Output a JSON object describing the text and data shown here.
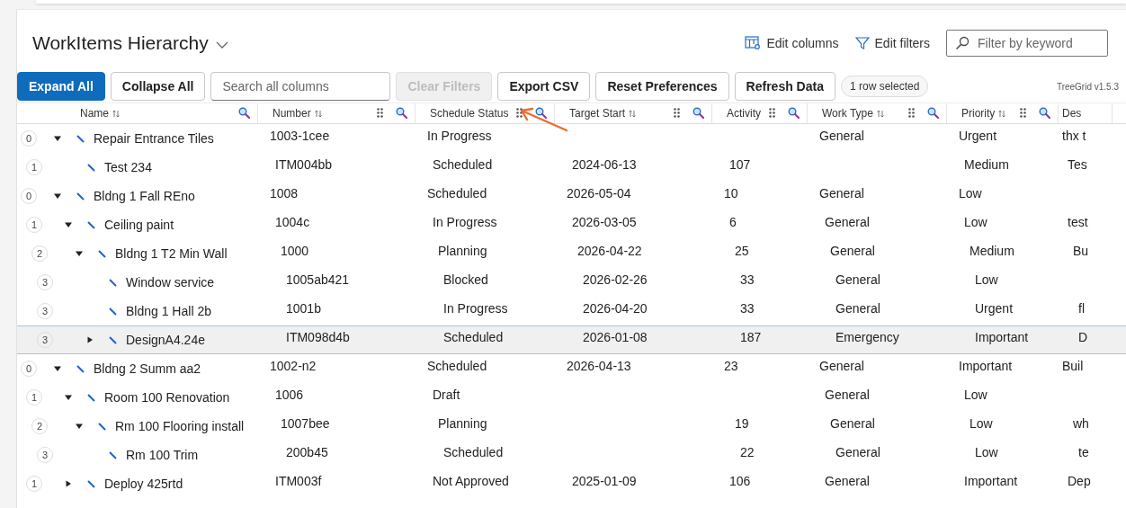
{
  "header": {
    "title": "WorkItems Hierarchy",
    "actions": [
      {
        "kind": "columns",
        "label": "Edit columns"
      },
      {
        "kind": "filters",
        "label": "Edit filters"
      }
    ],
    "keyword_filter": {
      "placeholder": "Filter by keyword"
    }
  },
  "toolbar": {
    "buttons": [
      {
        "label": "Expand All",
        "kind": "primary",
        "disabled": false
      },
      {
        "label": "Collapse All",
        "kind": "default",
        "disabled": false
      },
      {
        "kind": "search",
        "placeholder": "Search all columns"
      },
      {
        "label": "Clear Filters",
        "kind": "default",
        "disabled": true
      },
      {
        "label": "Export CSV",
        "kind": "default",
        "disabled": false
      },
      {
        "label": "Reset Preferences",
        "kind": "default",
        "disabled": false
      },
      {
        "label": "Refresh Data",
        "kind": "default",
        "disabled": false
      }
    ],
    "selection_count": "1 row selected",
    "version": "TreeGrid v1.5.3"
  },
  "table": {
    "columns": [
      {
        "label": "Name",
        "sortable": true,
        "movable": false,
        "filterable": true
      },
      {
        "label": "Number",
        "sortable": true,
        "movable": true,
        "filterable": true
      },
      {
        "label": "Schedule Status",
        "sortable": false,
        "movable": true,
        "filterable": true
      },
      {
        "label": "Target Start",
        "sortable": true,
        "movable": true,
        "filterable": true
      },
      {
        "label": "Activity",
        "sortable": false,
        "movable": true,
        "filterable": true
      },
      {
        "label": "Work Type",
        "sortable": true,
        "movable": true,
        "filterable": true
      },
      {
        "label": "Priority",
        "sortable": true,
        "movable": true,
        "filterable": true
      },
      {
        "label": "Des",
        "sortable": false,
        "movable": false,
        "filterable": false
      }
    ],
    "rows": [
      {
        "level": "0",
        "expanded": true,
        "selected": false,
        "cells": [
          "Repair Entrance Tiles",
          "1003-1cee",
          "In Progress",
          "",
          "",
          "General",
          "Urgent",
          "thx t"
        ],
        "children": [
          {
            "level": "1",
            "selected": false,
            "cells": [
              "Test 234",
              "ITM004bb",
              "Scheduled",
              "2024-06-13",
              "107",
              "",
              "Medium",
              "Tes"
            ]
          }
        ]
      },
      {
        "level": "0",
        "expanded": true,
        "selected": false,
        "cells": [
          "Bldng 1 Fall REno",
          "1008",
          "Scheduled",
          "2026-05-04",
          "10",
          "General",
          "Low",
          ""
        ],
        "children": [
          {
            "level": "1",
            "expanded": true,
            "selected": false,
            "cells": [
              "Ceiling paint",
              "1004c",
              "In Progress",
              "2026-03-05",
              "6",
              "General",
              "Low",
              "test"
            ],
            "children": [
              {
                "level": "2",
                "expanded": true,
                "selected": false,
                "cells": [
                  "Bldng 1 T2 Min Wall",
                  "1000",
                  "Planning",
                  "2026-04-22",
                  "25",
                  "General",
                  "Medium",
                  "Bu"
                ],
                "children": [
                  {
                    "level": "3",
                    "selected": false,
                    "cells": [
                      "Window service",
                      "1005ab421",
                      "Blocked",
                      "2026-02-26",
                      "33",
                      "General",
                      "Low",
                      ""
                    ]
                  },
                  {
                    "level": "3",
                    "selected": false,
                    "cells": [
                      "Bldng 1 Hall 2b",
                      "1001b",
                      "In Progress",
                      "2026-04-20",
                      "33",
                      "General",
                      "Urgent",
                      "fl"
                    ]
                  },
                  {
                    "level": "3",
                    "expanded": false,
                    "selected": true,
                    "cells": [
                      "DesignA4.24e",
                      "ITM098d4b",
                      "Scheduled",
                      "2026-01-08",
                      "187",
                      "Emergency",
                      "Important",
                      "D"
                    ]
                  }
                ]
              }
            ]
          }
        ]
      },
      {
        "level": "0",
        "expanded": true,
        "selected": false,
        "cells": [
          "Bldng 2 Summ aa2",
          "1002-n2",
          "Scheduled",
          "2026-04-13",
          "23",
          "General",
          "Important",
          "Buil"
        ],
        "children": [
          {
            "level": "1",
            "expanded": true,
            "selected": false,
            "cells": [
              "Room 100 Renovation",
              "1006",
              "Draft",
              "",
              "",
              "General",
              "Low",
              ""
            ],
            "children": [
              {
                "level": "2",
                "expanded": true,
                "selected": false,
                "cells": [
                  "Rm 100 Flooring install",
                  "1007bee",
                  "Planning",
                  "",
                  "19",
                  "General",
                  "Low",
                  "wh"
                ],
                "children": [
                  {
                    "level": "3",
                    "selected": false,
                    "cells": [
                      "Rm 100 Trim",
                      "200b45",
                      "Scheduled",
                      "",
                      "22",
                      "General",
                      "Low",
                      "te"
                    ]
                  }
                ]
              }
            ]
          },
          {
            "level": "1",
            "expanded": false,
            "selected": false,
            "cells": [
              "Deploy 425rtd",
              "ITM003f",
              "Not Approved",
              "2025-01-09",
              "106",
              "General",
              "Important",
              "Dep"
            ]
          }
        ]
      }
    ]
  }
}
